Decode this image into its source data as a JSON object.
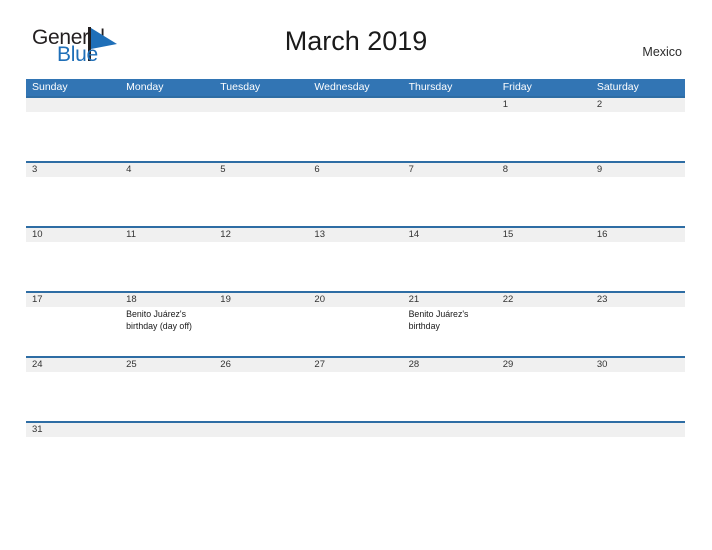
{
  "brand": {
    "name_part1": "General",
    "name_part2": "Blue",
    "flag_color": "#1f6fb8"
  },
  "header": {
    "title": "March 2019",
    "country": "Mexico"
  },
  "theme": {
    "header_blue": "#3275b4",
    "row_border_blue": "#2e6da4",
    "date_strip_gray": "#f0f0f0",
    "text_dark": "#1a1a1a"
  },
  "calendar": {
    "weekdays": [
      "Sunday",
      "Monday",
      "Tuesday",
      "Wednesday",
      "Thursday",
      "Friday",
      "Saturday"
    ],
    "weeks": [
      {
        "days": [
          {
            "num": "",
            "event": ""
          },
          {
            "num": "",
            "event": ""
          },
          {
            "num": "",
            "event": ""
          },
          {
            "num": "",
            "event": ""
          },
          {
            "num": "",
            "event": ""
          },
          {
            "num": "1",
            "event": ""
          },
          {
            "num": "2",
            "event": ""
          }
        ]
      },
      {
        "days": [
          {
            "num": "3",
            "event": ""
          },
          {
            "num": "4",
            "event": ""
          },
          {
            "num": "5",
            "event": ""
          },
          {
            "num": "6",
            "event": ""
          },
          {
            "num": "7",
            "event": ""
          },
          {
            "num": "8",
            "event": ""
          },
          {
            "num": "9",
            "event": ""
          }
        ]
      },
      {
        "days": [
          {
            "num": "10",
            "event": ""
          },
          {
            "num": "11",
            "event": ""
          },
          {
            "num": "12",
            "event": ""
          },
          {
            "num": "13",
            "event": ""
          },
          {
            "num": "14",
            "event": ""
          },
          {
            "num": "15",
            "event": ""
          },
          {
            "num": "16",
            "event": ""
          }
        ]
      },
      {
        "days": [
          {
            "num": "17",
            "event": ""
          },
          {
            "num": "18",
            "event": "Benito Juárez's birthday (day off)"
          },
          {
            "num": "19",
            "event": ""
          },
          {
            "num": "20",
            "event": ""
          },
          {
            "num": "21",
            "event": "Benito Juárez's birthday"
          },
          {
            "num": "22",
            "event": ""
          },
          {
            "num": "23",
            "event": ""
          }
        ]
      },
      {
        "days": [
          {
            "num": "24",
            "event": ""
          },
          {
            "num": "25",
            "event": ""
          },
          {
            "num": "26",
            "event": ""
          },
          {
            "num": "27",
            "event": ""
          },
          {
            "num": "28",
            "event": ""
          },
          {
            "num": "29",
            "event": ""
          },
          {
            "num": "30",
            "event": ""
          }
        ]
      },
      {
        "short": true,
        "days": [
          {
            "num": "31",
            "event": ""
          },
          {
            "num": "",
            "event": ""
          },
          {
            "num": "",
            "event": ""
          },
          {
            "num": "",
            "event": ""
          },
          {
            "num": "",
            "event": ""
          },
          {
            "num": "",
            "event": ""
          },
          {
            "num": "",
            "event": ""
          }
        ]
      }
    ]
  }
}
